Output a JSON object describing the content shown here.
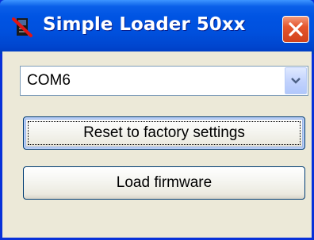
{
  "window": {
    "title": "Simple Loader 50xx",
    "icon": "red-cross-app-icon",
    "close_icon": "close-icon"
  },
  "port_select": {
    "value": "COM6",
    "dropdown_icon": "chevron-down-icon"
  },
  "buttons": {
    "reset_label": "Reset to factory settings",
    "load_label": "Load firmware"
  },
  "colors": {
    "titlebar": "#0054e3",
    "client_bg": "#ece9d8",
    "close_red": "#e5562d"
  }
}
